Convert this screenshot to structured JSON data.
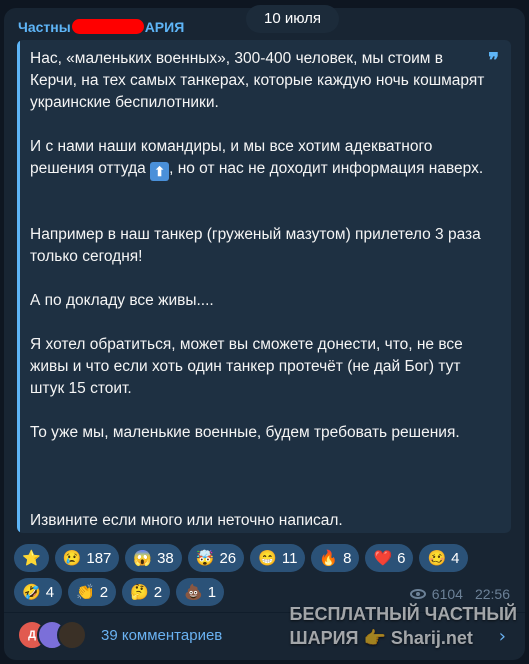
{
  "header": {
    "channel_name_start": "Частны",
    "channel_name_end": "АРИЯ",
    "date": "10 июля"
  },
  "quote": {
    "icon": "quote-mark-icon",
    "quote_mark": "❞",
    "paragraphs": [
      "Нас, «маленьких военных»,  300-400 человек, мы стоим в Керчи, на тех самых танкерах, которые каждую ночь кошмарят украинские беспилотники.",
      "И с нами наши командиры, и мы все хотим адекватного решения оттуда",
      "Например в наш танкер (груженый мазутом) прилетело 3 раза только сегодня!",
      "А по докладу все живы....",
      "Я хотел обратиться, может вы сможете донести, что, не все живы и что если хоть один танкер протечёт (не дай Бог) тут штук 15 стоит.",
      "То уже мы, маленькие военные, будем требовать решения.",
      "Извините если много или неточно написал."
    ],
    "para2_tail": ", но от нас не доходит информация наверх.",
    "up_icon": "⬆"
  },
  "reactions": [
    {
      "emoji": "⭐",
      "count": ""
    },
    {
      "emoji": "😢",
      "count": "187"
    },
    {
      "emoji": "😱",
      "count": "38"
    },
    {
      "emoji": "🤯",
      "count": "26"
    },
    {
      "emoji": "😁",
      "count": "11"
    },
    {
      "emoji": "🔥",
      "count": "8"
    },
    {
      "emoji": "❤️",
      "count": "6"
    },
    {
      "emoji": "🥴",
      "count": "4"
    },
    {
      "emoji": "🤣",
      "count": "4"
    },
    {
      "emoji": "👏",
      "count": "2"
    },
    {
      "emoji": "🤔",
      "count": "2"
    },
    {
      "emoji": "💩",
      "count": "1"
    }
  ],
  "meta": {
    "views": "6104",
    "time": "22:56"
  },
  "comments": {
    "avatar_letter": "Д",
    "label": "39 комментариев",
    "arrow": "›"
  },
  "watermark": {
    "line1": "БЕСПЛАТНЫЙ  ЧАСТНЫЙ",
    "line2": "ШАРИЯ 👉 Sharij.net"
  },
  "colors": {
    "background": "#0e1621",
    "bubble": "#182533",
    "accent": "#5eb5f7",
    "reaction_bg": "#2b5278",
    "redaction": "#ff0000"
  }
}
